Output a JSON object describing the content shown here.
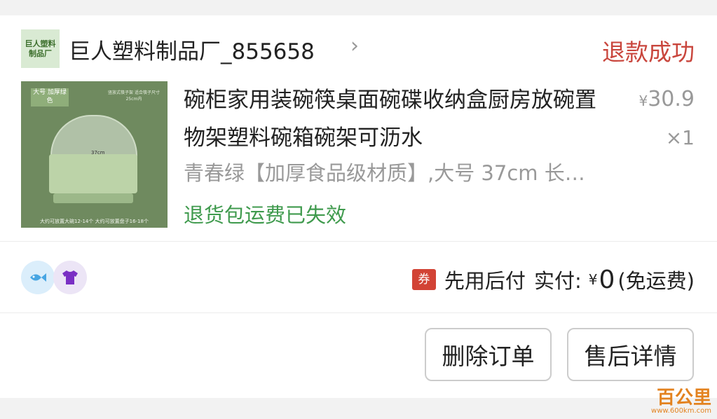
{
  "store": {
    "logo_text": "巨人塑料制品厂",
    "name": "巨人塑料制品厂_855658",
    "chevron": "›"
  },
  "order": {
    "status": "退款成功"
  },
  "product": {
    "image_tag": "大号 加厚绿色",
    "image_note": "竖放式筷子架 适合筷子尺寸25cm内",
    "image_footer": "大约可放置大碗12-14个   大约可放置盘子16-18个",
    "image_dim": "37cm",
    "title": "碗柜家用装碗筷桌面碗碟收纳盒厨房放碗置物架塑料碗箱碗架可沥水",
    "price_symbol": "¥",
    "price": "30.9",
    "quantity": "×1",
    "sku": "青春绿【加厚食品级材质】,大号 37cm 长…",
    "return_note": "退货包运费已失效"
  },
  "services": {
    "icons": [
      "fish-icon",
      "shirt-icon"
    ]
  },
  "payment": {
    "coupon_label": "券",
    "method": "先用后付",
    "paid_label": "实付:",
    "currency": "¥",
    "amount": "0",
    "shipping_note": "(免运费)"
  },
  "actions": {
    "delete_label": "删除订单",
    "aftersale_label": "售后详情"
  },
  "watermark": {
    "text": "百公里",
    "url": "www.600km.com"
  },
  "colors": {
    "status_red": "#c9463d",
    "note_green": "#3f9a4d",
    "coupon_red": "#d24335"
  }
}
